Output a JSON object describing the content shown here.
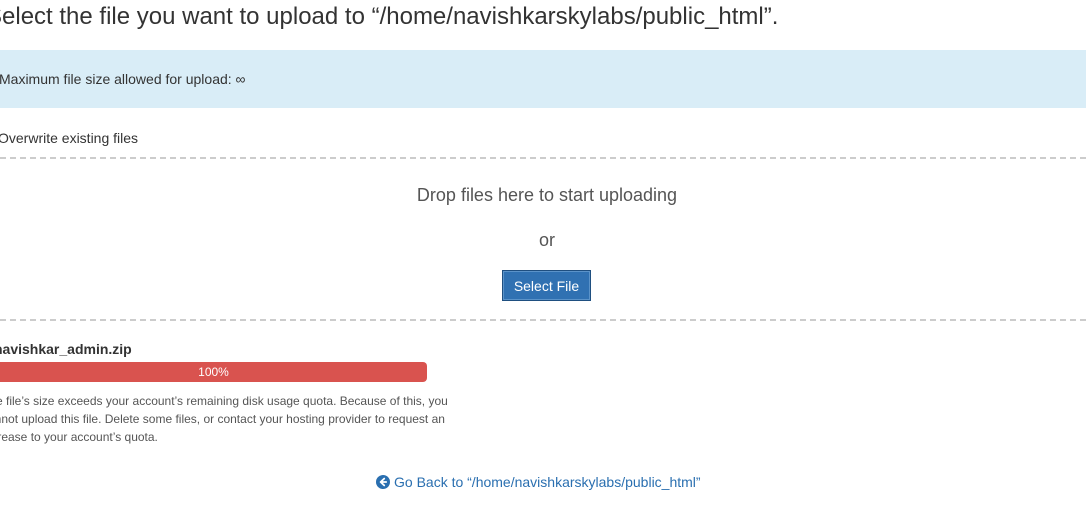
{
  "page": {
    "title": "Select the file you want to upload to “/home/navishkarskylabs/public_html”."
  },
  "banner": {
    "max_size_text": "Maximum file size allowed for upload: ∞"
  },
  "options": {
    "overwrite_label": "Overwrite existing files"
  },
  "dropzone": {
    "drop_text": "Drop files here to start uploading",
    "or_text": "or",
    "select_button_label": "Select File"
  },
  "upload": {
    "file_name": "navishkar_admin.zip",
    "progress_label": "100%",
    "progress_fraction": 1.0,
    "status_color": "#d9534f",
    "error_message": "The file’s size exceeds your account’s remaining disk usage quota. Because of this, you cannot upload this file. Delete some files, or contact your hosting provider to request an increase to your account’s quota."
  },
  "footer": {
    "go_back_icon": "arrow-circle-left-icon",
    "go_back_label": "Go Back to “/home/navishkarskylabs/public_html”"
  },
  "colors": {
    "banner_bg": "#d9edf7",
    "button_bg": "#3071b2",
    "link": "#2a6fb0",
    "error": "#d9534f"
  }
}
